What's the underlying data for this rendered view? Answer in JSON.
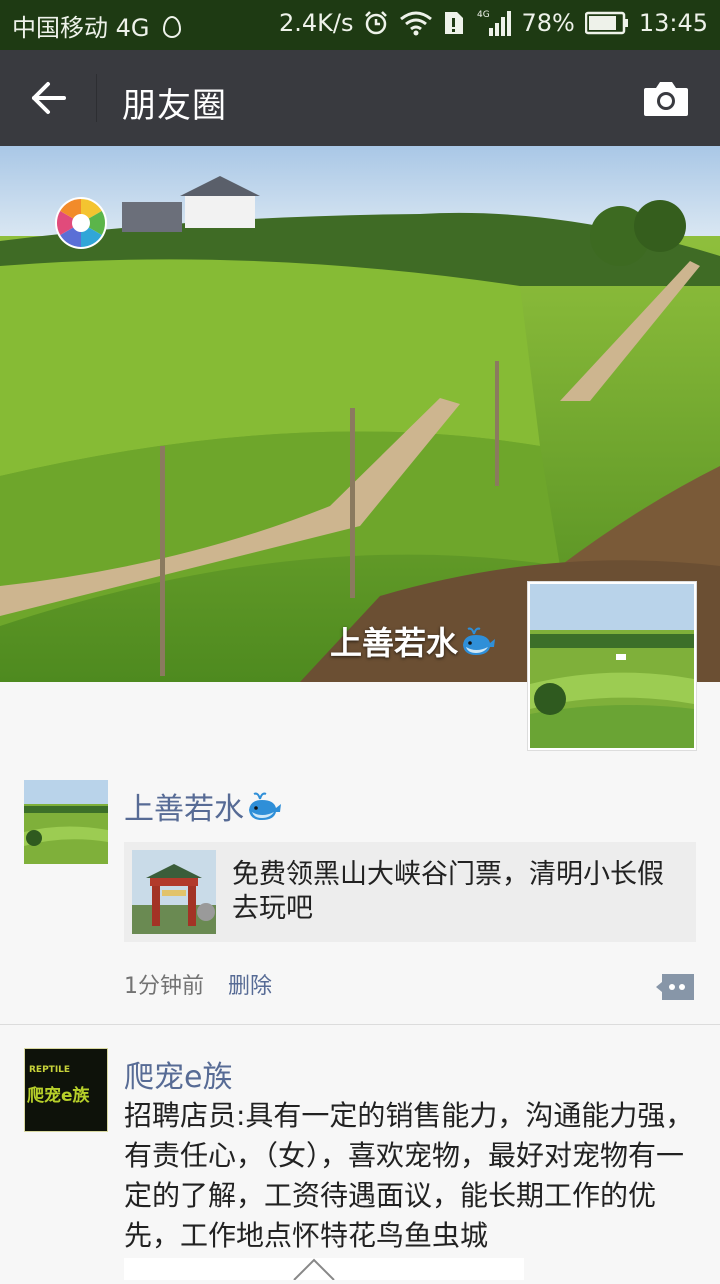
{
  "status_bar": {
    "carrier": "中国移动 4G",
    "speed": "2.4K/s",
    "battery": "78%",
    "time": "13:45"
  },
  "title_bar": {
    "title": "朋友圈"
  },
  "cover": {
    "name": "上善若水"
  },
  "posts": [
    {
      "nickname": "上善若水",
      "link_text": "免费领黑山大峡谷门票，清明小长假去玩吧",
      "time": "1分钟前",
      "delete_label": "删除"
    },
    {
      "nickname": "爬宠e族",
      "text": "招聘店员:具有一定的销售能力，沟通能力强，有责任心，（女），喜欢宠物，最好对宠物有一定的了解，工资待遇面议，能长期工作的优先，工作地点怀特花鸟鱼虫城",
      "avatar_text": "爬宠e族",
      "avatar_subtext": "REPTILE"
    }
  ],
  "colors": {
    "status_bar_bg": "#1e3a13",
    "title_bar_bg": "#393a3f",
    "nickname": "#576b95",
    "link_card_bg": "#ededed"
  },
  "icons": [
    "back-arrow-icon",
    "camera-icon",
    "signal-icon",
    "wifi-icon",
    "alarm-icon",
    "battery-icon",
    "whale-emoji-icon",
    "comment-icon"
  ]
}
